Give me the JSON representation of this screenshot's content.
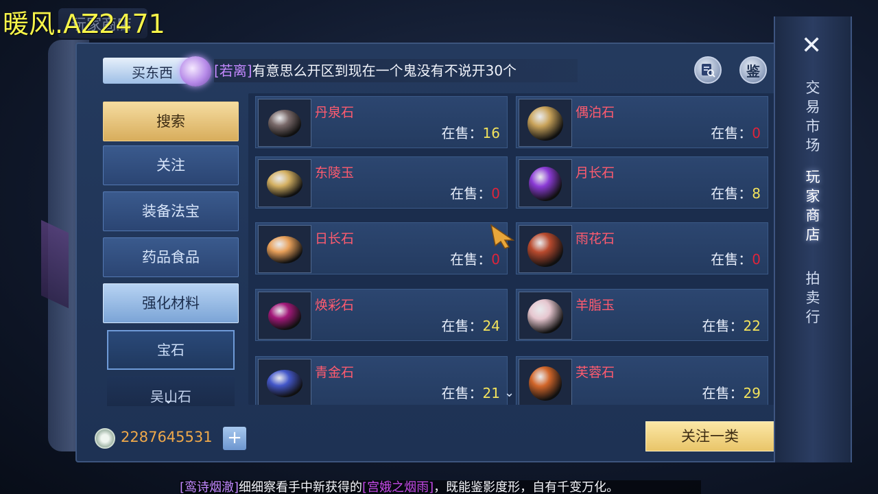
{
  "watermark": "暖风.AZ2471",
  "title_tab": "玩家商店",
  "top_bar": {
    "buy_tab_label": "买东西",
    "broadcast_speaker": "[若离]",
    "broadcast_text": "有意思么开区到现在一个鬼没有不说开30个",
    "identify_btn": "鉴"
  },
  "sidebar": {
    "search": "搜索",
    "items": [
      "关注",
      "装备法宝",
      "药品食品",
      "强化材料"
    ],
    "sub_items": [
      "宝石",
      "吴山石"
    ]
  },
  "stock_label": "在售：",
  "items": [
    {
      "name": "丹泉石",
      "stock": "16",
      "color": "#7a6a6a",
      "icon": "gem-raw-icon"
    },
    {
      "name": "偶泊石",
      "stock": "0",
      "color": "#c9a35a",
      "icon": "gold-orb-icon"
    },
    {
      "name": "东陵玉",
      "stock": "0",
      "color": "#d4b062",
      "icon": "gold-jade-icon"
    },
    {
      "name": "月长石",
      "stock": "8",
      "color": "#8b3bd6",
      "icon": "purple-oval-icon"
    },
    {
      "name": "日长石",
      "stock": "0",
      "color": "#e8a05a",
      "icon": "sunstone-icon"
    },
    {
      "name": "雨花石",
      "stock": "0",
      "color": "#b84a2e",
      "icon": "banded-orb-icon"
    },
    {
      "name": "焕彩石",
      "stock": "24",
      "color": "#a3197a",
      "icon": "magenta-gem-icon"
    },
    {
      "name": "羊脂玉",
      "stock": "22",
      "color": "#e6c6cf",
      "icon": "white-jade-icon"
    },
    {
      "name": "青金石",
      "stock": "21",
      "color": "#4357c9",
      "icon": "lapis-icon"
    },
    {
      "name": "芙蓉石",
      "stock": "29",
      "color": "#d2662a",
      "icon": "rose-quartz-icon"
    }
  ],
  "bottom": {
    "money": "2287645531",
    "plus": "+",
    "follow_category": "关注一类"
  },
  "right_nav": {
    "items": [
      "交易市场",
      "玩家商店",
      "拍卖行"
    ],
    "current": "玩家商店"
  },
  "chat": {
    "who": "[鸾诗烟澈]",
    "text_a": "细细察看手中新获得的",
    "item": "[宫娥之烟雨]",
    "text_b": "，既能鉴影度形，自有千变万化。"
  }
}
